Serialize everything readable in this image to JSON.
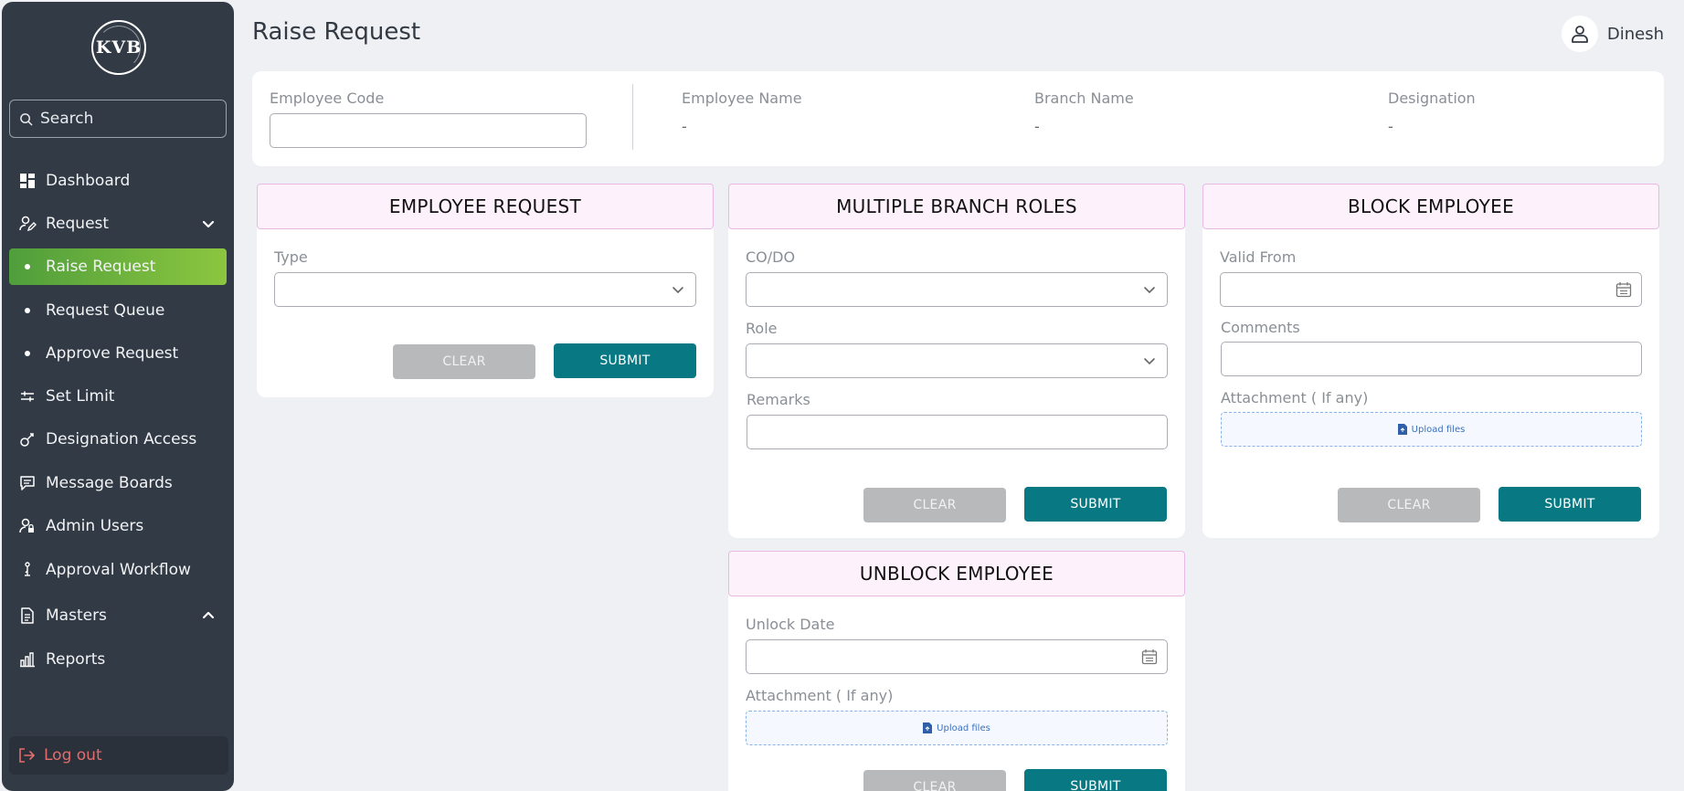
{
  "app": {
    "logo_text": "KVB",
    "brand_color": "#323a46",
    "accent_color": "#087883",
    "active_gradient": [
      "#4f9e3c",
      "#8cc63f"
    ]
  },
  "search": {
    "placeholder": "Search"
  },
  "sidebar": {
    "items": [
      {
        "label": "Dashboard",
        "icon": "dashboard-icon"
      },
      {
        "label": "Request",
        "icon": "user-edit-icon",
        "expanded": true
      },
      {
        "label": "Raise Request",
        "icon": "bullet",
        "active": true
      },
      {
        "label": "Request Queue",
        "icon": "bullet"
      },
      {
        "label": "Approve Request",
        "icon": "bullet"
      },
      {
        "label": "Set Limit",
        "icon": "sliders-icon"
      },
      {
        "label": "Designation Access",
        "icon": "key-icon"
      },
      {
        "label": "Message Boards",
        "icon": "message-icon"
      },
      {
        "label": "Admin Users",
        "icon": "admin-user-icon"
      },
      {
        "label": "Approval Workflow",
        "icon": "workflow-icon"
      },
      {
        "label": "Masters",
        "icon": "document-icon",
        "expanded": false
      },
      {
        "label": "Reports",
        "icon": "chart-icon"
      }
    ],
    "logout_label": "Log out"
  },
  "header": {
    "title": "Raise Request",
    "user_name": "Dinesh"
  },
  "employee_info": {
    "code_label": "Employee Code",
    "code_value": "",
    "name_label": "Employee Name",
    "name_value": "-",
    "branch_label": "Branch Name",
    "branch_value": "-",
    "designation_label": "Designation",
    "designation_value": "-"
  },
  "panels": {
    "employee_request": {
      "title": "EMPLOYEE REQUEST",
      "type_label": "Type",
      "type_value": "",
      "clear_label": "CLEAR",
      "submit_label": "SUBMIT"
    },
    "multiple_branch_roles": {
      "title": "MULTIPLE BRANCH ROLES",
      "codo_label": "CO/DO",
      "role_label": "Role",
      "remarks_label": "Remarks",
      "clear_label": "CLEAR",
      "submit_label": "SUBMIT"
    },
    "block_employee": {
      "title": "BLOCK EMPLOYEE",
      "valid_from_label": "Valid From",
      "comments_label": "Comments",
      "attachment_label": "Attachment ( If any)",
      "upload_label": "Upload files",
      "clear_label": "CLEAR",
      "submit_label": "SUBMIT"
    },
    "unblock_employee": {
      "title": "UNBLOCK EMPLOYEE",
      "unlock_date_label": "Unlock Date",
      "attachment_label": "Attachment ( If any)",
      "upload_label": "Upload files",
      "clear_label": "CLEAR",
      "submit_label": "SUBMIT"
    }
  }
}
